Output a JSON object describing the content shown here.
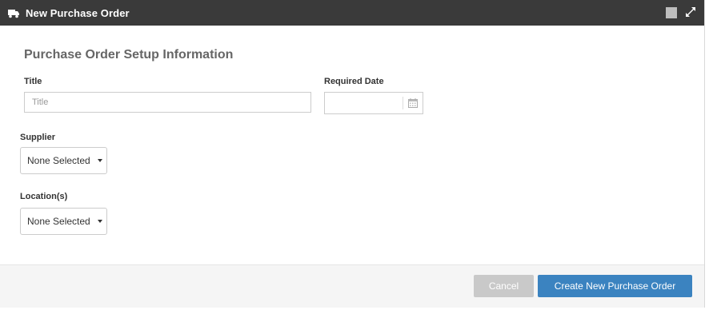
{
  "window": {
    "title": "New Purchase Order",
    "title_icon": "truck-icon",
    "controls": [
      "minimize-square-icon",
      "expand-icon"
    ]
  },
  "form": {
    "section_title": "Purchase Order Setup Information",
    "title_label": "Title",
    "title_placeholder": "Title",
    "title_value": "",
    "required_date_label": "Required Date",
    "required_date_value": "",
    "supplier_label": "Supplier",
    "supplier_value": "None Selected",
    "locations_label": "Location(s)",
    "locations_value": "None Selected"
  },
  "footer": {
    "cancel_label": "Cancel",
    "create_label": "Create New Purchase Order"
  },
  "colors": {
    "titlebar": "#3a3a3a",
    "primary": "#3b83c0",
    "disabled": "#c9c9c9"
  }
}
